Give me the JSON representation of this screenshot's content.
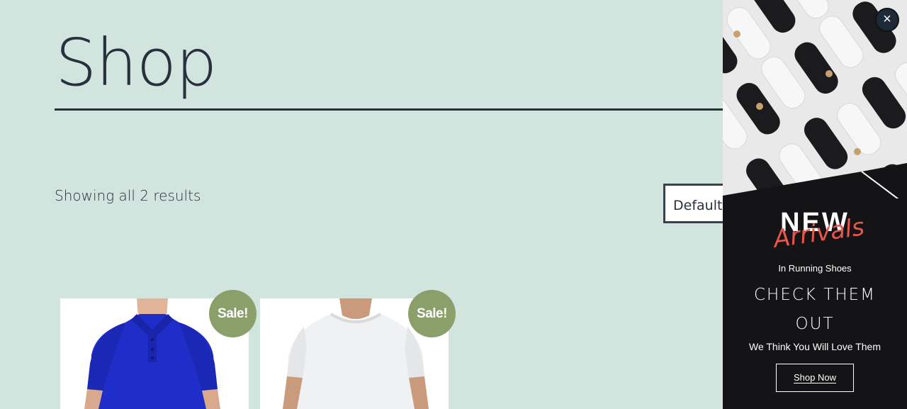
{
  "page": {
    "title": "Shop"
  },
  "shop": {
    "result_count": "Showing all 2 results",
    "orderby_value": "Default"
  },
  "products": [
    {
      "badge": "Sale!",
      "image": "blue polo shirt"
    },
    {
      "badge": "Sale!",
      "image": "white t-shirt"
    }
  ],
  "popup": {
    "close_label": "×",
    "headline": "NEW",
    "headline_accent": "Arrivals",
    "subline": "In Running Shoes",
    "check_line1": "CHECK THEM",
    "check_line2": "OUT",
    "tagline": "We Think You Will Love Them",
    "cta": "Shop Now",
    "accent_color": "#e9564a",
    "background_color": "#141316"
  },
  "colors": {
    "page_bg": "#d1e4dd",
    "text": "#28303d",
    "sale_badge": "#8a9f6a"
  }
}
